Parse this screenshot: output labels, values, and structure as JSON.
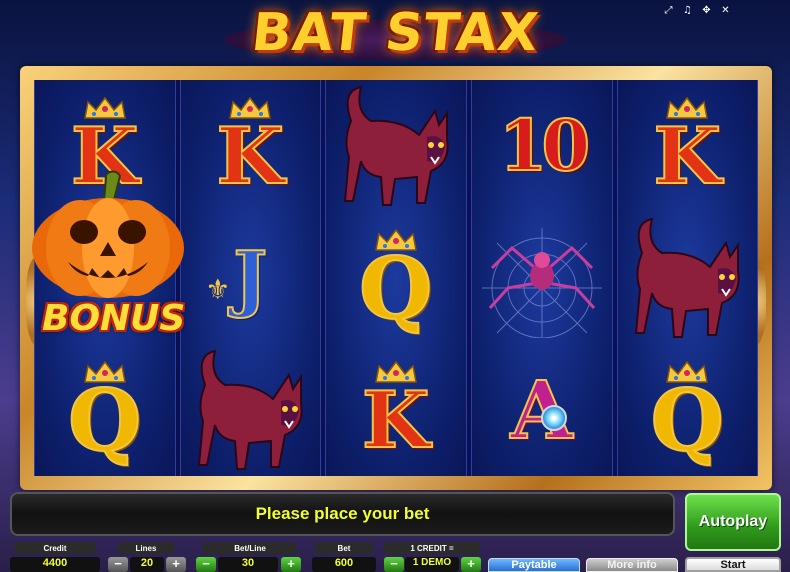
{
  "title": "BAT STAX",
  "window_controls": [
    {
      "name": "fullscreen-icon",
      "glyph": "⤢"
    },
    {
      "name": "sound-icon",
      "glyph": "♫"
    },
    {
      "name": "settings-icon",
      "glyph": "✥"
    },
    {
      "name": "close-icon",
      "glyph": "✕"
    }
  ],
  "reels": [
    [
      "K",
      "pumpkin-bonus",
      "Q"
    ],
    [
      "K",
      "J",
      "cat"
    ],
    [
      "cat",
      "Q",
      "K"
    ],
    [
      "10",
      "spider",
      "A"
    ],
    [
      "K",
      "cat",
      "Q"
    ]
  ],
  "bonus_label": "BONUS",
  "message": "Please place your bet",
  "autoplay_label": "Autoplay",
  "credit": {
    "label": "Credit",
    "value": "4400"
  },
  "lines": {
    "label": "Lines",
    "value": "20"
  },
  "bet_line": {
    "label": "Bet/Line",
    "value": "30"
  },
  "bet": {
    "label": "Bet",
    "value": "600"
  },
  "credit_rate": {
    "label": "1 CREDIT =",
    "value": "1 DEMO"
  },
  "paytable_label": "Paytable",
  "more_info_label": "More info",
  "start_label": "Start",
  "minus": "−",
  "plus": "+",
  "colors": {
    "message": "#f2ff2a",
    "autoplay": "#2f9a1a",
    "frame": "#d89a3a"
  }
}
